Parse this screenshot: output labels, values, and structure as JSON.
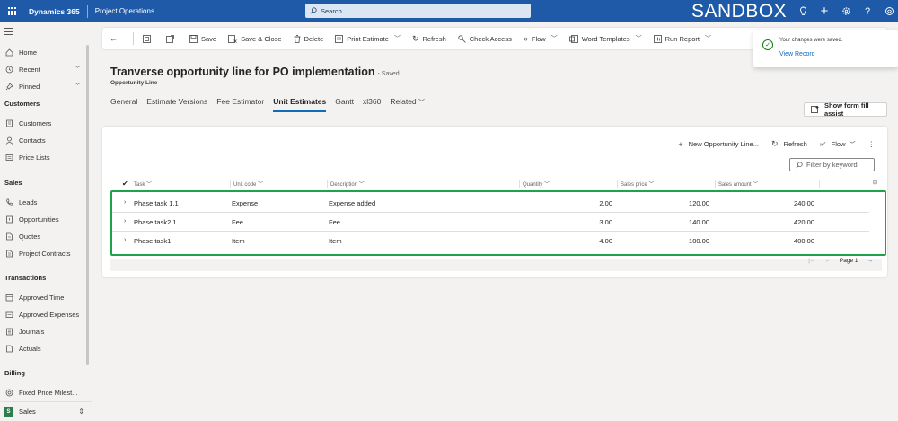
{
  "topbar": {
    "brand": "Dynamics 365",
    "app": "Project Operations",
    "search_placeholder": "Search",
    "environment": "SANDBOX",
    "icons": [
      "lightbulb-icon",
      "plus-icon",
      "gear-icon",
      "help-icon",
      "copilot-icon"
    ]
  },
  "sidebar": {
    "top_items": [
      {
        "label": "Home",
        "icon": "home-icon"
      },
      {
        "label": "Recent",
        "icon": "clock-icon"
      },
      {
        "label": "Pinned",
        "icon": "pin-icon"
      }
    ],
    "groups": [
      {
        "title": "Customers",
        "items": [
          {
            "label": "Customers",
            "icon": "building-icon"
          },
          {
            "label": "Contacts",
            "icon": "person-icon"
          },
          {
            "label": "Price Lists",
            "icon": "list-icon"
          }
        ]
      },
      {
        "title": "Sales",
        "items": [
          {
            "label": "Leads",
            "icon": "phone-icon"
          },
          {
            "label": "Opportunities",
            "icon": "opportunity-icon"
          },
          {
            "label": "Quotes",
            "icon": "document-icon"
          },
          {
            "label": "Project Contracts",
            "icon": "contract-icon"
          }
        ]
      },
      {
        "title": "Transactions",
        "items": [
          {
            "label": "Approved Time",
            "icon": "calendar-icon"
          },
          {
            "label": "Approved Expenses",
            "icon": "expense-icon"
          },
          {
            "label": "Journals",
            "icon": "journal-icon"
          },
          {
            "label": "Actuals",
            "icon": "document-icon"
          }
        ]
      },
      {
        "title": "Billing",
        "items": [
          {
            "label": "Fixed Price Milest...",
            "icon": "milestone-icon"
          }
        ]
      }
    ],
    "area": {
      "badge": "S",
      "label": "Sales"
    }
  },
  "commandbar": {
    "items": [
      {
        "label": "Save",
        "icon": "save-icon"
      },
      {
        "label": "Save & Close",
        "icon": "save-close-icon"
      },
      {
        "label": "Delete",
        "icon": "delete-icon"
      },
      {
        "label": "Print Estimate",
        "icon": "print-icon",
        "dropdown": true
      },
      {
        "label": "Refresh",
        "icon": "refresh-icon"
      },
      {
        "label": "Check Access",
        "icon": "key-icon"
      },
      {
        "label": "Flow",
        "icon": "flow-icon",
        "dropdown": true
      },
      {
        "label": "Word Templates",
        "icon": "word-icon",
        "dropdown": true
      },
      {
        "label": "Run Report",
        "icon": "report-icon",
        "dropdown": true
      }
    ]
  },
  "toast": {
    "message": "Your changes were saved.",
    "link": "View Record"
  },
  "record": {
    "title": "Tranverse opportunity line for PO implementation",
    "saved": "- Saved",
    "entity": "Opportunity Line"
  },
  "tabs": [
    "General",
    "Estimate Versions",
    "Fee Estimator",
    "Unit Estimates",
    "Gantt",
    "xl360",
    "Related"
  ],
  "active_tab": "Unit Estimates",
  "assist_button": "Show form fill assist",
  "grid": {
    "tools": [
      {
        "label": "New Opportunity Line...",
        "icon": "plus-icon"
      },
      {
        "label": "Refresh",
        "icon": "refresh-icon"
      },
      {
        "label": "Flow",
        "icon": "flow-icon"
      }
    ],
    "filter_placeholder": "Filter by keyword",
    "columns": [
      "Task",
      "Unit code",
      "Description",
      "Quantity",
      "Sales price",
      "Sales amount"
    ],
    "rows": [
      {
        "task": "Phase task 1.1",
        "unit": "Expense",
        "description": "Expense added",
        "quantity": "2.00",
        "price": "120.00",
        "amount": "240.00"
      },
      {
        "task": "Phase task2.1",
        "unit": "Fee",
        "description": "Fee",
        "quantity": "3.00",
        "price": "140.00",
        "amount": "420.00"
      },
      {
        "task": "Phase task1",
        "unit": "Item",
        "description": "Item",
        "quantity": "4.00",
        "price": "100.00",
        "amount": "400.00"
      }
    ],
    "page_label": "Page 1"
  },
  "colors": {
    "topbar": "#1e5aa8",
    "accent": "#0f6cbd",
    "highlight": "#1ea24a",
    "success": "#107c10"
  }
}
